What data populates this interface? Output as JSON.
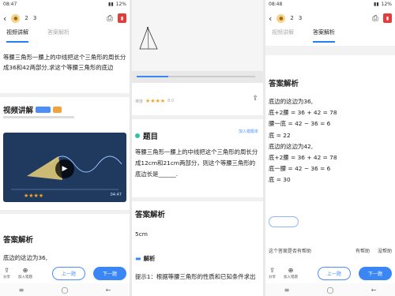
{
  "panel1": {
    "status": {
      "time": "08:47",
      "battery": "12%"
    },
    "topbar": {
      "count1": "2",
      "count2": "3"
    },
    "tabs": [
      "视频讲解",
      "答案解析"
    ],
    "question": "等腰三角形一腰上的中线把这个三角形的周长分成36和42两部分,求这个等腰三角形的底边",
    "video_section_title": "视频讲解",
    "video_duration": "04:47",
    "answer_title": "答案解析",
    "answer_first": "底边的这边为36,",
    "bottom": {
      "share": "分享",
      "item2": "加入错题",
      "prev": "上一题",
      "next": "下一题"
    }
  },
  "panel2": {
    "rating_label": "难度",
    "score": "8.0",
    "title": "题目",
    "add_label": "加入错题本",
    "question": "等腰三角形一腰上的中线把这个三角形的周长分成12cm和21cm两部分，则这个等腰三角形的底边长是______.",
    "answer_title": "答案解析",
    "answer": "5cm",
    "analysis_title": "解析",
    "hint": "提示1：根据等腰三角形的性质和已知条件求出"
  },
  "panel3": {
    "status": {
      "time": "08:48",
      "battery": "12%"
    },
    "topbar": {
      "count1": "2",
      "count2": "3"
    },
    "tabs": [
      "视频讲解",
      "答案解析"
    ],
    "answer_title": "答案解析",
    "lines": [
      "底边的这边为36,",
      "底+2腰 = 36 + 42 = 78",
      "腰一底 = 42 − 36 = 6",
      "底 = 22",
      "底边的这边为42,",
      "底+2腰 = 36 + 42 = 78",
      "底一腰 = 42 − 36 = 6",
      "底 = 30"
    ],
    "feedback_q": "这个答案是否有帮助",
    "yes": "有帮助",
    "no": "没帮助",
    "bottom": {
      "share": "分享",
      "item2": "加入错题",
      "prev": "上一题",
      "next": "下一题"
    }
  }
}
